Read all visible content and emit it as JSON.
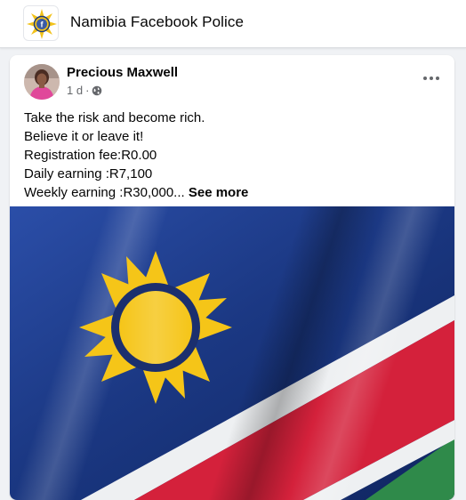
{
  "group": {
    "name": "Namibia Facebook Police"
  },
  "post": {
    "author": "Precious Maxwell",
    "time": "1 d",
    "separator": "·",
    "lines": [
      "Take the risk and become rich.",
      "Believe it or leave it!",
      "Registration fee:R0.00",
      "Daily earning :R7,100",
      "Weekly earning :R30,000..."
    ],
    "see_more": "See more",
    "privacy_icon": "globe-icon",
    "image_subject": "Namibian flag"
  },
  "colors": {
    "flag_blue": "#1f3f8f",
    "flag_red": "#d4213b",
    "flag_green": "#2f8a4a",
    "flag_sun": "#f5c518",
    "muted_text": "#65676b"
  }
}
